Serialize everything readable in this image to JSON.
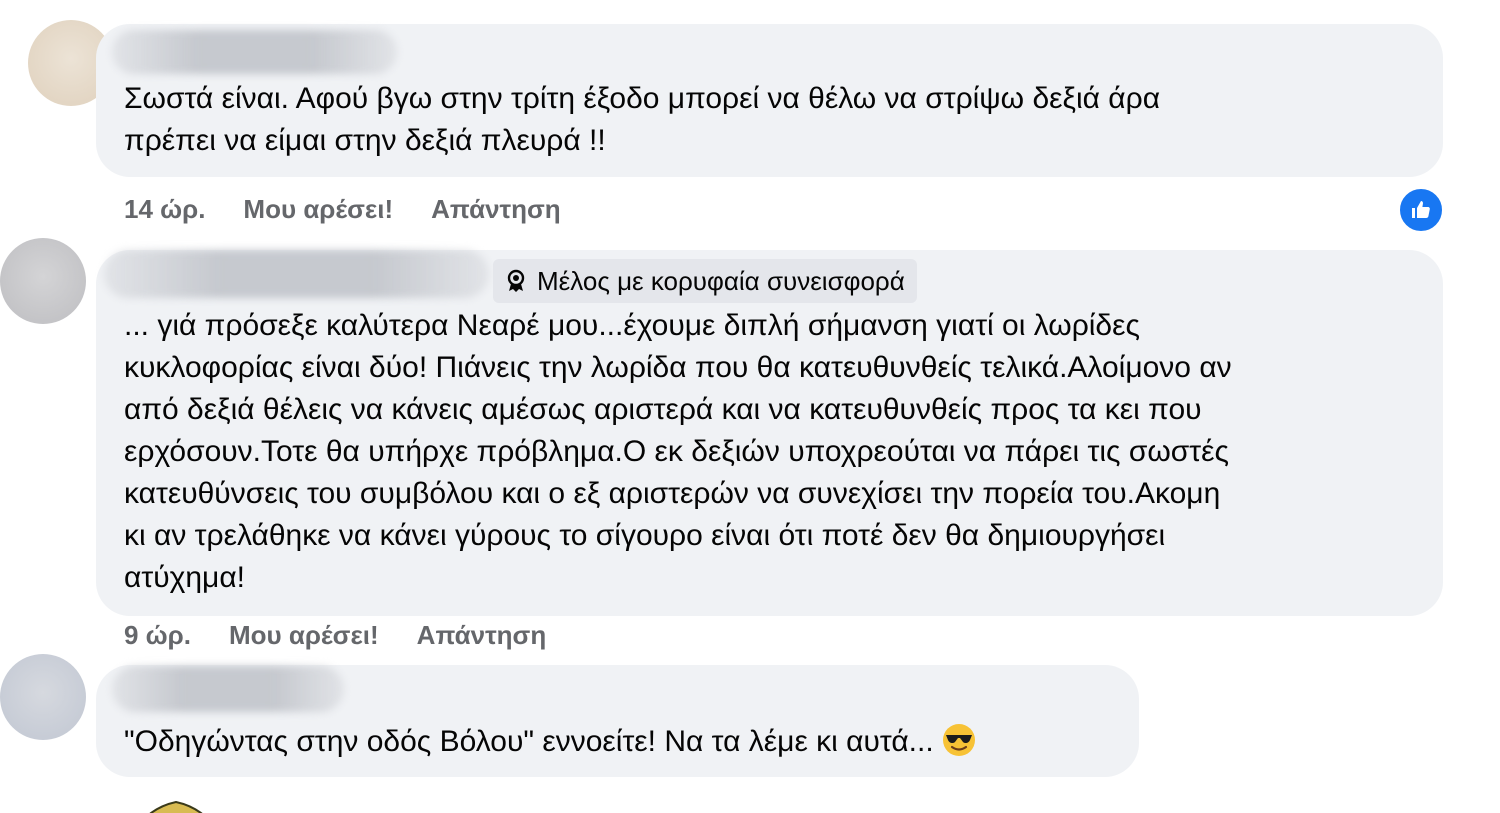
{
  "comments": [
    {
      "text": "Σωστά είναι. Αφού βγω στην τρίτη έξοδο μπορεί να θέλω να στρίψω δεξιά άρα\nπρέπει να είμαι στην δεξιά πλευρά !!",
      "time": "14 ώρ.",
      "like_label": "Μου αρέσει!",
      "reply_label": "Απάντηση",
      "reaction_icon": "thumbs-up-icon"
    },
    {
      "badge": "Μέλος με κορυφαία συνεισφορά",
      "badge_icon": "top-contributor-icon",
      "text": "... γιά πρόσεξε καλύτερα Νεαρέ μου...έχουμε διπλή σήμανση γιατί οι λωρίδες\nκυκλοφορίας είναι δύο! Πιάνεις την λωρίδα που θα κατευθυνθείς τελικά.Αλοίμονο αν\nαπό δεξιά θέλεις να κάνεις αμέσως αριστερά και να κατευθυνθείς προς τα κει που\nερχόσουν.Τοτε θα υπήρχε πρόβλημα.Ο εκ δεξιών υποχρεούται να πάρει τις σωστές\nκατευθύνσεις του συμβόλου και ο εξ αριστερών να συνεχίσει την πορεία του.Ακομη\nκι αν τρελάθηκε να κάνει γύρους το σίγουρο είναι ότι ποτέ δεν θα δημιουργήσει\nατύχημα!",
      "time": "9 ώρ.",
      "like_label": "Μου αρέσει!",
      "reply_label": "Απάντηση"
    },
    {
      "text": "\"Οδηγώντας στην οδός Βόλου\" εννοείτε! Να τα λέμε κι αυτά...",
      "emoji": "smiling-face-with-sunglasses-icon"
    }
  ],
  "colors": {
    "bubble": "#f0f2f5",
    "meta_text": "#65676b",
    "like_blue": "#1877f2"
  }
}
